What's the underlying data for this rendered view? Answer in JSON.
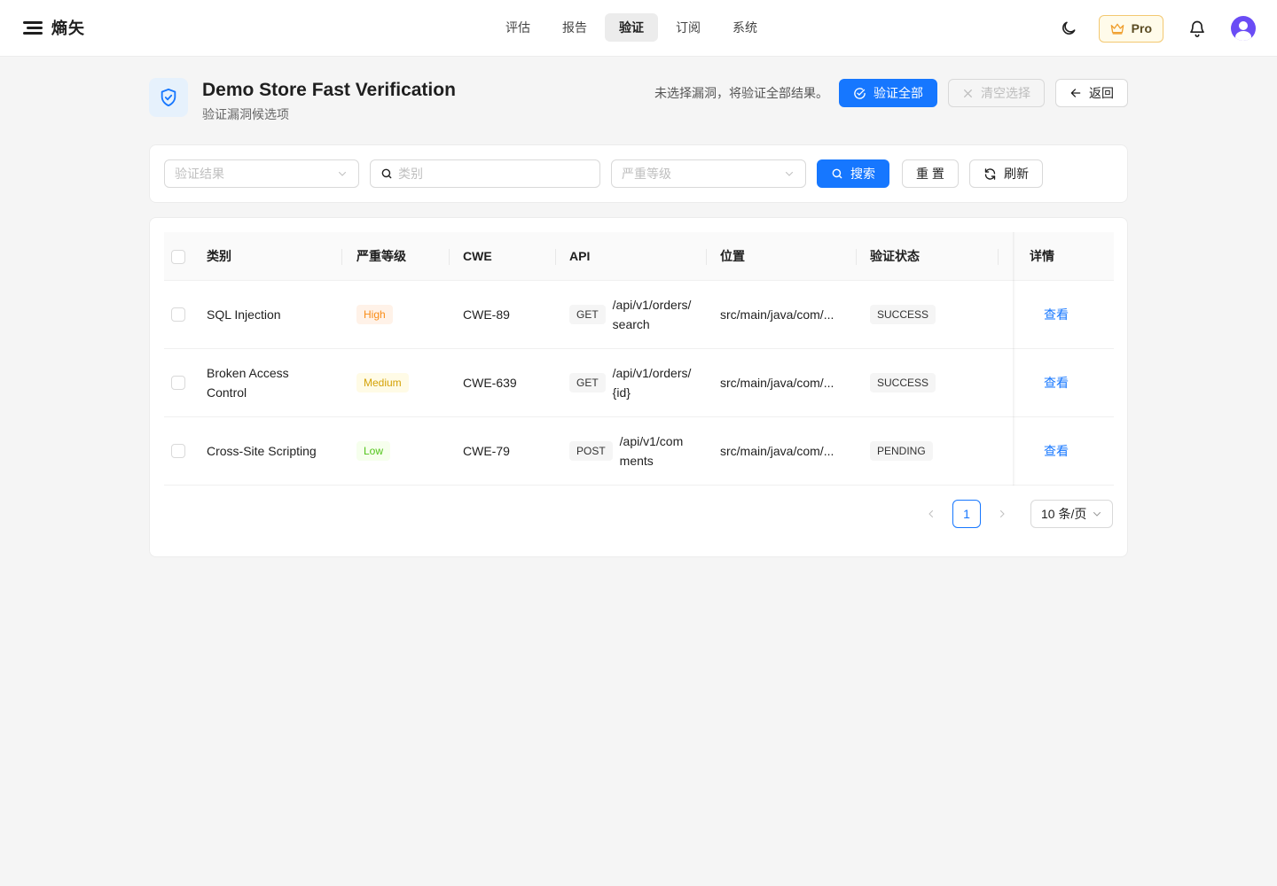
{
  "app": {
    "brand": "熵矢"
  },
  "nav": {
    "items": [
      {
        "label": "评估",
        "active": false
      },
      {
        "label": "报告",
        "active": false
      },
      {
        "label": "验证",
        "active": true
      },
      {
        "label": "订阅",
        "active": false
      },
      {
        "label": "系统",
        "active": false
      }
    ]
  },
  "topbar": {
    "pro_label": "Pro",
    "icons": [
      "moon-icon",
      "crown-icon",
      "bell-icon",
      "avatar"
    ]
  },
  "header": {
    "title": "Demo Store Fast Verification",
    "subtitle": "验证漏洞候选项",
    "hint": "未选择漏洞，将验证全部结果。",
    "verify_all_label": "验证全部",
    "clear_selection_label": "清空选择",
    "back_label": "返回"
  },
  "filters": {
    "result_placeholder": "验证结果",
    "category_placeholder": "类别",
    "severity_placeholder": "严重等级",
    "search_label": "搜索",
    "reset_label": "重 置",
    "refresh_label": "刷新"
  },
  "table": {
    "columns": {
      "category": "类别",
      "severity": "严重等级",
      "cwe": "CWE",
      "api": "API",
      "location": "位置",
      "status": "验证状态",
      "detail": "详情"
    },
    "rows": [
      {
        "category_line1": "SQL Injection",
        "category_line2": "",
        "severity": "High",
        "severity_level": "high",
        "cwe": "CWE-89",
        "method": "GET",
        "api_line1": "/api/v1/orders/",
        "api_line2": "search",
        "location": "src/main/java/com/...",
        "status": "SUCCESS",
        "detail": "查看"
      },
      {
        "category_line1": "Broken Access",
        "category_line2": "Control",
        "severity": "Medium",
        "severity_level": "medium",
        "cwe": "CWE-639",
        "method": "GET",
        "api_line1": "/api/v1/orders/",
        "api_line2": "{id}",
        "location": "src/main/java/com/...",
        "status": "SUCCESS",
        "detail": "查看"
      },
      {
        "category_line1": "Cross-Site Scripting",
        "category_line2": "",
        "severity": "Low",
        "severity_level": "low",
        "cwe": "CWE-79",
        "method": "POST",
        "api_line1": "/api/v1/com",
        "api_line2": "ments",
        "location": "src/main/java/com/...",
        "status": "PENDING",
        "detail": "查看"
      }
    ]
  },
  "pagination": {
    "current_page": "1",
    "page_size_label": "10 条/页"
  },
  "colors": {
    "primary": "#1677ff",
    "high": "#fa8c16",
    "medium": "#d4a106",
    "low": "#52c41a"
  }
}
